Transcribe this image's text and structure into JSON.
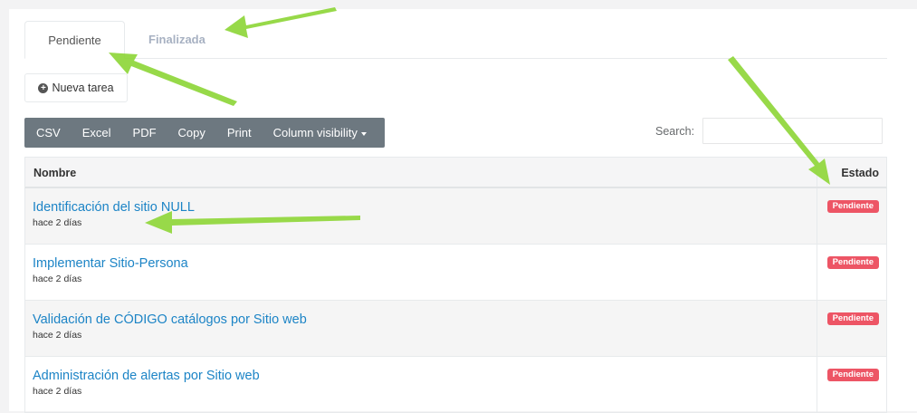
{
  "tabs": [
    {
      "label": "Pendiente",
      "active": true
    },
    {
      "label": "Finalizada",
      "active": false
    }
  ],
  "new_task_label": "Nueva tarea",
  "toolbar": {
    "csv": "CSV",
    "excel": "Excel",
    "pdf": "PDF",
    "copy": "Copy",
    "print": "Print",
    "column_visibility": "Column visibility"
  },
  "search": {
    "label": "Search:",
    "value": ""
  },
  "table": {
    "headers": {
      "name": "Nombre",
      "status": "Estado"
    },
    "rows": [
      {
        "title": "Identificación del sitio NULL",
        "time": "hace 2 días",
        "status": "Pendiente"
      },
      {
        "title": "Implementar Sitio-Persona",
        "time": "hace 2 días",
        "status": "Pendiente"
      },
      {
        "title": "Validación de CÓDIGO catálogos por Sitio web",
        "time": "hace 2 días",
        "status": "Pendiente"
      },
      {
        "title": "Administración de alertas por Sitio web",
        "time": "hace 2 días",
        "status": "Pendiente"
      }
    ]
  },
  "colors": {
    "link": "#1c84c6",
    "badge": "#ed5565",
    "toolbar": "#6d7880",
    "annotation_arrow": "#8fd63a"
  }
}
